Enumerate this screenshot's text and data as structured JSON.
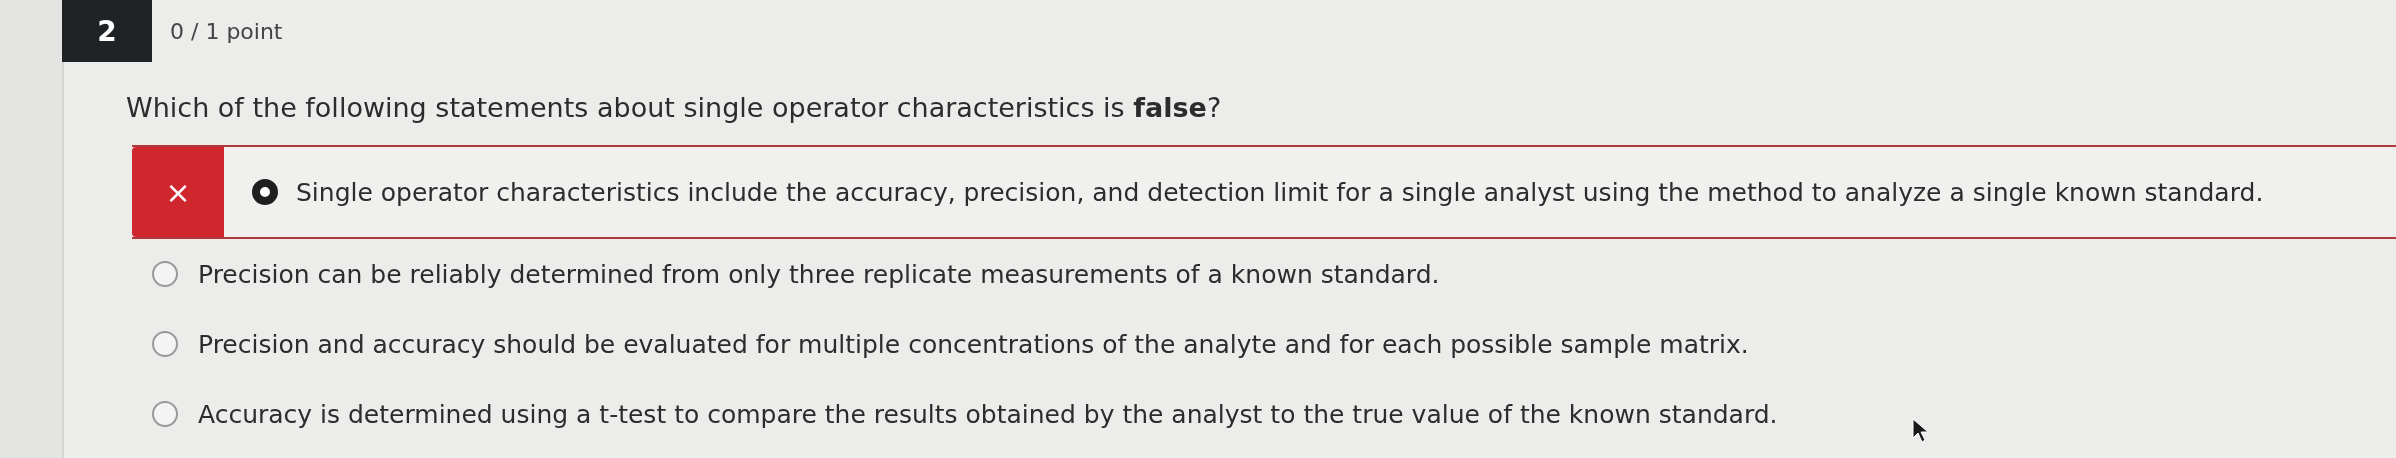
{
  "question": {
    "number": "2",
    "score": "0 / 1 point",
    "text": "Which of the following statements about single operator characteristics is **false**?"
  },
  "answers": [
    {
      "kind": "incorrect",
      "mark": "×",
      "selected": true,
      "text": "Single operator characteristics include the accuracy, precision, and detection limit for a single analyst using the method to analyze a single known standard."
    },
    {
      "kind": "plain",
      "selected": false,
      "text": "Precision can be reliably determined from only three replicate measurements of a known standard."
    },
    {
      "kind": "plain",
      "selected": false,
      "text": "Precision and accuracy should be evaluated for multiple concentrations of the analyte and for each possible sample matrix."
    },
    {
      "kind": "plain",
      "selected": false,
      "text": "Accuracy is determined using a t-test to compare the results obtained by the analyst to the true value of the known standard."
    }
  ]
}
